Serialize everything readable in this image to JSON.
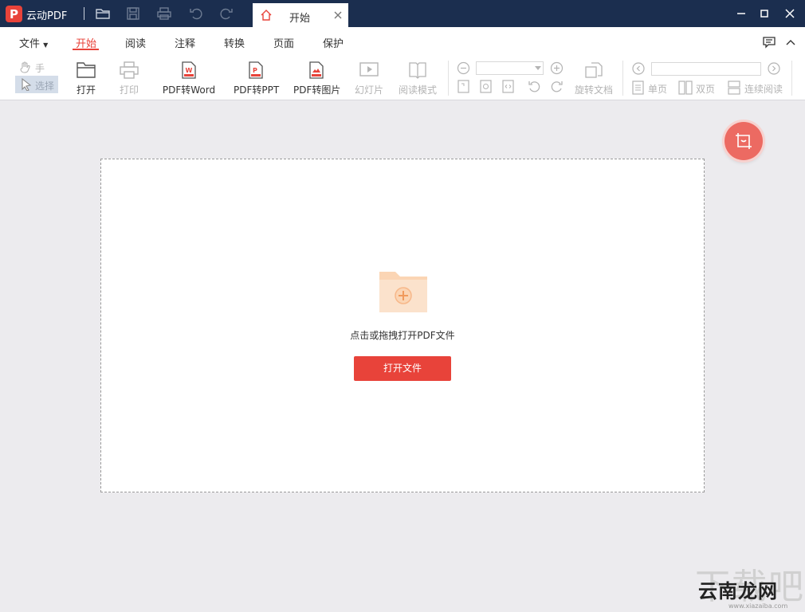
{
  "app": {
    "title": "云动PDF",
    "logo_letter": "P"
  },
  "titlebar": {
    "quick_actions": [
      "open-folder-icon",
      "save-icon",
      "print-icon",
      "undo-icon",
      "redo-icon"
    ],
    "tab": {
      "label": "开始",
      "icon": "home-icon",
      "close": "close-icon"
    },
    "window_buttons": [
      "minimize-icon",
      "maximize-icon",
      "close-icon"
    ],
    "color": "#1b2e4f"
  },
  "menu": {
    "file": "文件",
    "items": [
      "开始",
      "阅读",
      "注释",
      "转换",
      "页面",
      "保护"
    ],
    "active": "开始",
    "right_icons": [
      "comment-icon",
      "collapse-icon"
    ]
  },
  "toolbar": {
    "hand": "手型",
    "select": "选择",
    "open": "打开",
    "print": "打印",
    "pdf_to_word": "PDF转Word",
    "pdf_to_ppt": "PDF转PPT",
    "pdf_to_image": "PDF转图片",
    "slideshow": "幻灯片",
    "reading_mode": "阅读模式",
    "rotate_doc": "旋转文档",
    "single_page": "单页",
    "double_page": "双页",
    "continuous": "连续阅读",
    "zoom_value": "",
    "page_value": ""
  },
  "workspace": {
    "drop_text": "点击或拖拽打开PDF文件",
    "open_button": "打开文件",
    "accent": "#e8433a"
  },
  "watermark": {
    "ghost": "下载吧",
    "big": "云南龙网",
    "small": "www.xiazaiba.com"
  }
}
